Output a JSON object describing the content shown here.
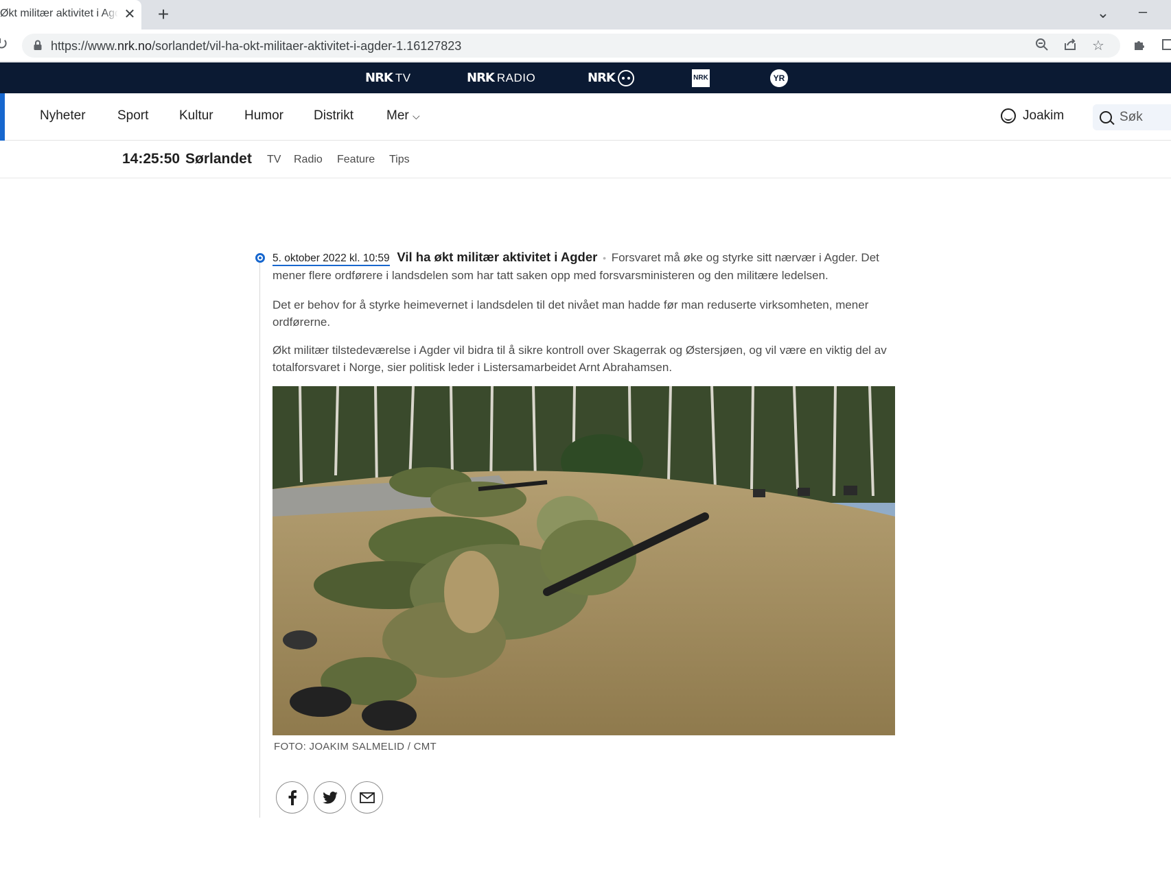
{
  "browser": {
    "tab_title": "Økt militær aktivitet i Agder",
    "tab_close": "✕",
    "new_tab": "+",
    "url_prefix": "https://www.",
    "url_host": "nrk.no",
    "url_path": "/sorlandet/vil-ha-okt-militaer-aktivitet-i-agder-1.16127823"
  },
  "nrk_bar": {
    "items": [
      {
        "logo": "NRK",
        "label": "TV"
      },
      {
        "logo": "NRK",
        "label": "RADIO"
      },
      {
        "logo": "NRK",
        "label": ""
      },
      {
        "logo": "NRK P3",
        "label": ""
      },
      {
        "logo": "YR",
        "label": ""
      }
    ]
  },
  "main_nav": {
    "items": [
      "Nyheter",
      "Sport",
      "Kultur",
      "Humor",
      "Distrikt",
      "Mer"
    ],
    "user": "Joakim",
    "search_label": "Søk"
  },
  "sub_nav": {
    "clock": "14:25:50",
    "region": "Sørlandet",
    "links": [
      "TV",
      "Radio",
      "Feature",
      "Tips"
    ]
  },
  "article": {
    "date": "5. oktober 2022 kl. 10:59",
    "headline": "Vil ha økt militær aktivitet i Agder",
    "separator": "•",
    "lead": "Forsvaret må øke og styrke sitt nærvær i Agder. Det mener flere ordførere i landsdelen som har tatt saken opp med forsvarsministeren og den militære ledelsen.",
    "paragraphs": [
      "Det er behov for å styrke heimevernet i landsdelen til det nivået man hadde før man reduserte virksomheten, mener ordførerne.",
      "Økt militær tilstedeværelse i Agder vil bidra til å sikre kontroll over Skagerrak og Østersjøen, og vil være en viktig del av totalforsvaret i Norge, sier politisk leder i Listersamarbeidet Arnt Abrahamsen."
    ],
    "photo_caption": "FOTO: JOAKIM SALMELID / CMT"
  },
  "colors": {
    "nrk_navy": "#0b1a33",
    "accent_blue": "#1767ce"
  }
}
